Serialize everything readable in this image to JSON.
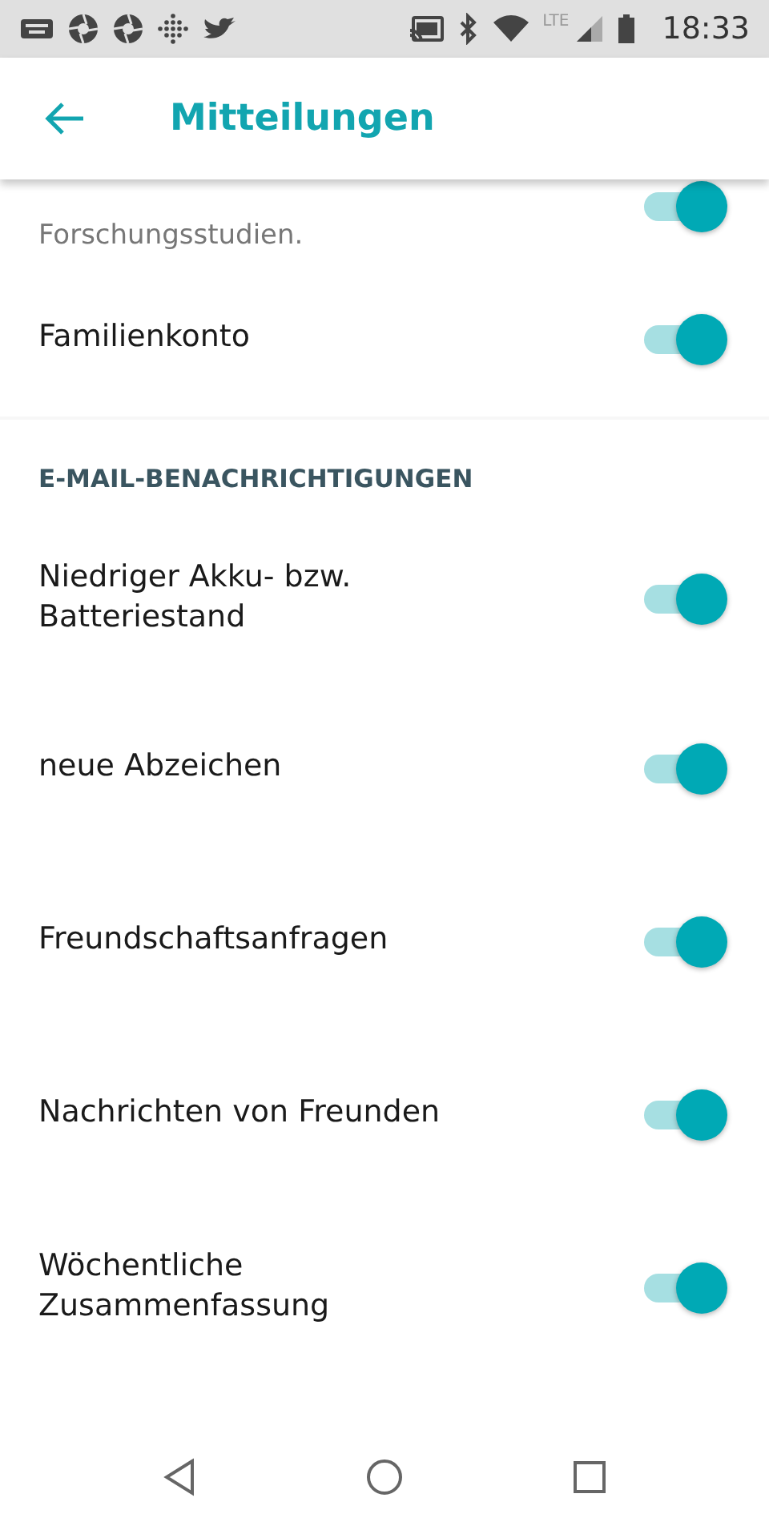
{
  "status_bar": {
    "network": "LTE",
    "time": "18:33"
  },
  "header": {
    "title": "Mitteilungen"
  },
  "top_items": [
    {
      "label": "Forschungsstudien.",
      "on": true,
      "kind": "partial"
    },
    {
      "label": "Familienkonto",
      "on": true,
      "kind": "row"
    }
  ],
  "email_section": {
    "heading": "E-MAIL-BENACHRICHTIGUNGEN",
    "items": [
      {
        "label": "Niedriger Akku- bzw. Batteriestand",
        "on": true
      },
      {
        "label": "neue Abzeichen",
        "on": true
      },
      {
        "label": "Freundschaftsanfragen",
        "on": true
      },
      {
        "label": "Nachrichten von Freunden",
        "on": true
      },
      {
        "label": "Wöchentliche Zusammenfassung",
        "on": true
      }
    ]
  }
}
